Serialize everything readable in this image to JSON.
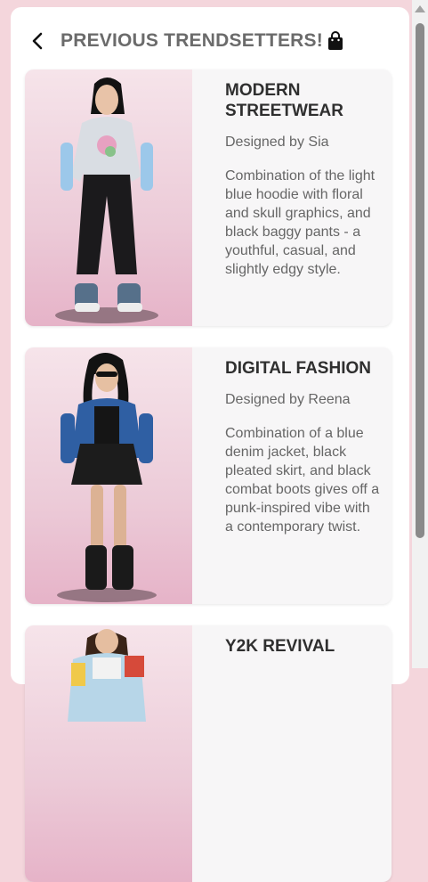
{
  "header": {
    "title": "PREVIOUS TRENDSETTERS!",
    "back_icon": "chevron-left-icon",
    "bag_icon": "shopping-bag-icon"
  },
  "cards": [
    {
      "title": "MODERN STREETWEAR",
      "designer": "Designed by Sia",
      "description": "Combination of the light blue hoodie with floral and skull graphics, and black baggy pants - a youthful, casual, and slightly edgy style."
    },
    {
      "title": "DIGITAL FASHION",
      "designer": "Designed by Reena",
      "description": "Combination of a blue denim jacket, black pleated skirt, and black combat boots gives off a punk-inspired vibe with a contemporary twist."
    },
    {
      "title": "Y2K REVIVAL",
      "designer": "",
      "description": ""
    }
  ],
  "colors": {
    "background": "#f4d6dc",
    "card_background": "#f7f6f7",
    "image_gradient_bottom": "#e6b3c8",
    "title_text": "#2f2f2f",
    "body_text": "#666666"
  }
}
